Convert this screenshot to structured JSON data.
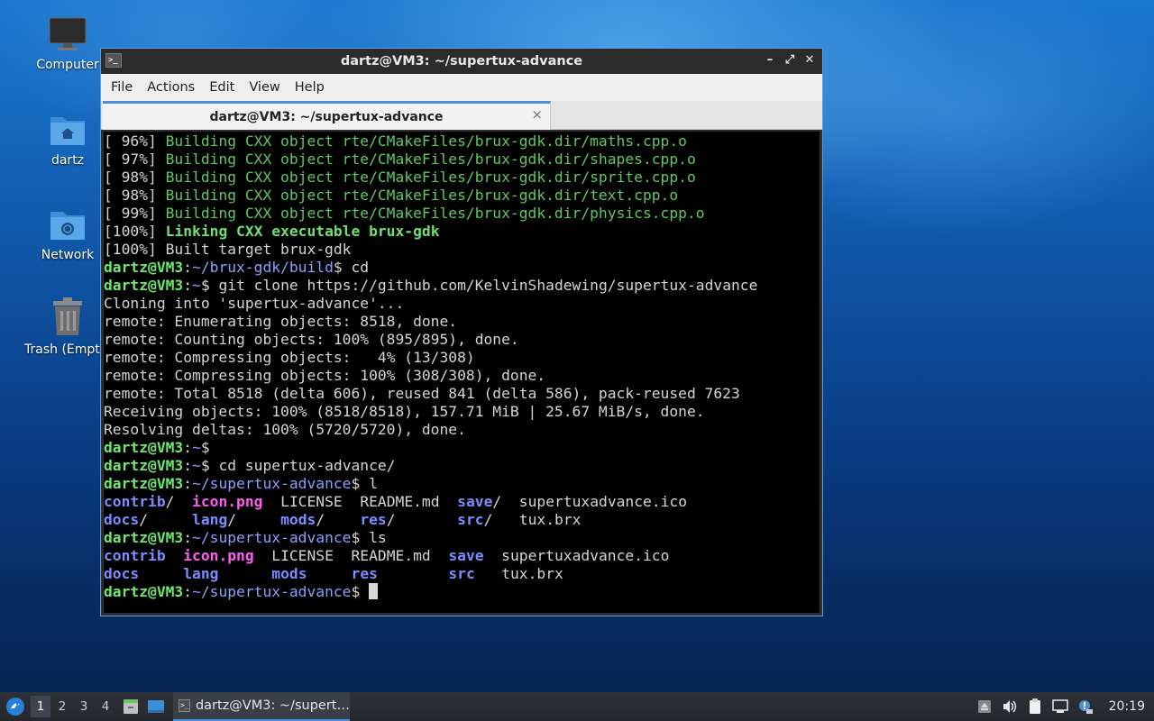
{
  "desktop": {
    "icons": [
      {
        "label": "Computer",
        "icon": "monitor-icon"
      },
      {
        "label": "dartz",
        "icon": "home-folder-icon"
      },
      {
        "label": "Network",
        "icon": "network-folder-icon"
      },
      {
        "label": "Trash (Empty)",
        "icon": "trash-icon"
      }
    ]
  },
  "window": {
    "title": "dartz@VM3: ~/supertux-advance",
    "controls": {
      "minimize": "–",
      "maximize": "⤢",
      "close": "✕"
    },
    "menu": [
      "File",
      "Actions",
      "Edit",
      "View",
      "Help"
    ],
    "tab": {
      "label": "dartz@VM3: ~/supertux-advance",
      "close": "×"
    }
  },
  "terminal": {
    "build_lines": [
      {
        "pct": "[ 96%] ",
        "text": "Building CXX object rte/CMakeFiles/brux-gdk.dir/maths.cpp.o"
      },
      {
        "pct": "[ 97%] ",
        "text": "Building CXX object rte/CMakeFiles/brux-gdk.dir/shapes.cpp.o"
      },
      {
        "pct": "[ 98%] ",
        "text": "Building CXX object rte/CMakeFiles/brux-gdk.dir/sprite.cpp.o"
      },
      {
        "pct": "[ 98%] ",
        "text": "Building CXX object rte/CMakeFiles/brux-gdk.dir/text.cpp.o"
      },
      {
        "pct": "[ 99%] ",
        "text": "Building CXX object rte/CMakeFiles/brux-gdk.dir/physics.cpp.o"
      }
    ],
    "link_pct": "[100%] ",
    "link_text": "Linking CXX executable brux-gdk",
    "built_line": "[100%] Built target brux-gdk",
    "user_host": "dartz@VM3",
    "path_build": "~/brux-gdk/build",
    "path_home": "~",
    "path_sta": "~/supertux-advance",
    "cmd_cd": " cd",
    "cmd_clone": " git clone https://github.com/KelvinShadewing/supertux-advance",
    "clone_output": [
      "Cloning into 'supertux-advance'...",
      "remote: Enumerating objects: 8518, done.",
      "remote: Counting objects: 100% (895/895), done.",
      "remote: Compressing objects:   4% (13/308)",
      "remote: Compressing objects: 100% (308/308), done.",
      "remote: Total 8518 (delta 606), reused 841 (delta 586), pack-reused 7623",
      "Receiving objects: 100% (8518/8518), 157.71 MiB | 25.67 MiB/s, done.",
      "Resolving deltas: 100% (5720/5720), done."
    ],
    "cmd_empty": "",
    "cmd_cd_sta": " cd supertux-advance/",
    "cmd_l": " l",
    "cmd_ls": " ls",
    "l_row1": {
      "a": "contrib",
      "b": "icon.png",
      "c": "LICENSE",
      "d": "README.md",
      "e": "save",
      "f": "supertuxadvance.ico"
    },
    "l_row2": {
      "a": "docs",
      "b": "lang",
      "c": "mods",
      "d": "res",
      "e": "src",
      "f": "tux.brx"
    },
    "ls_row1": {
      "a": "contrib",
      "b": "icon.png",
      "c": "LICENSE",
      "d": "README.md",
      "e": "save",
      "f": "supertuxadvance.ico"
    },
    "ls_row2": {
      "a": "docs",
      "b": "lang",
      "c": "mods",
      "d": "res",
      "e": "src",
      "f": "tux.brx"
    },
    "prompt_sep": ":",
    "prompt_dollar": "$"
  },
  "taskbar": {
    "workspaces": [
      "1",
      "2",
      "3",
      "4"
    ],
    "active_workspace": "1",
    "task_label": "dartz@VM3: ~/supert…",
    "clock": "20:19"
  },
  "colors": {
    "accent": "#4a90d9",
    "prompt_green": "#6ee86e",
    "dir_blue": "#7a8cff",
    "image_magenta": "#ff5cf0"
  }
}
